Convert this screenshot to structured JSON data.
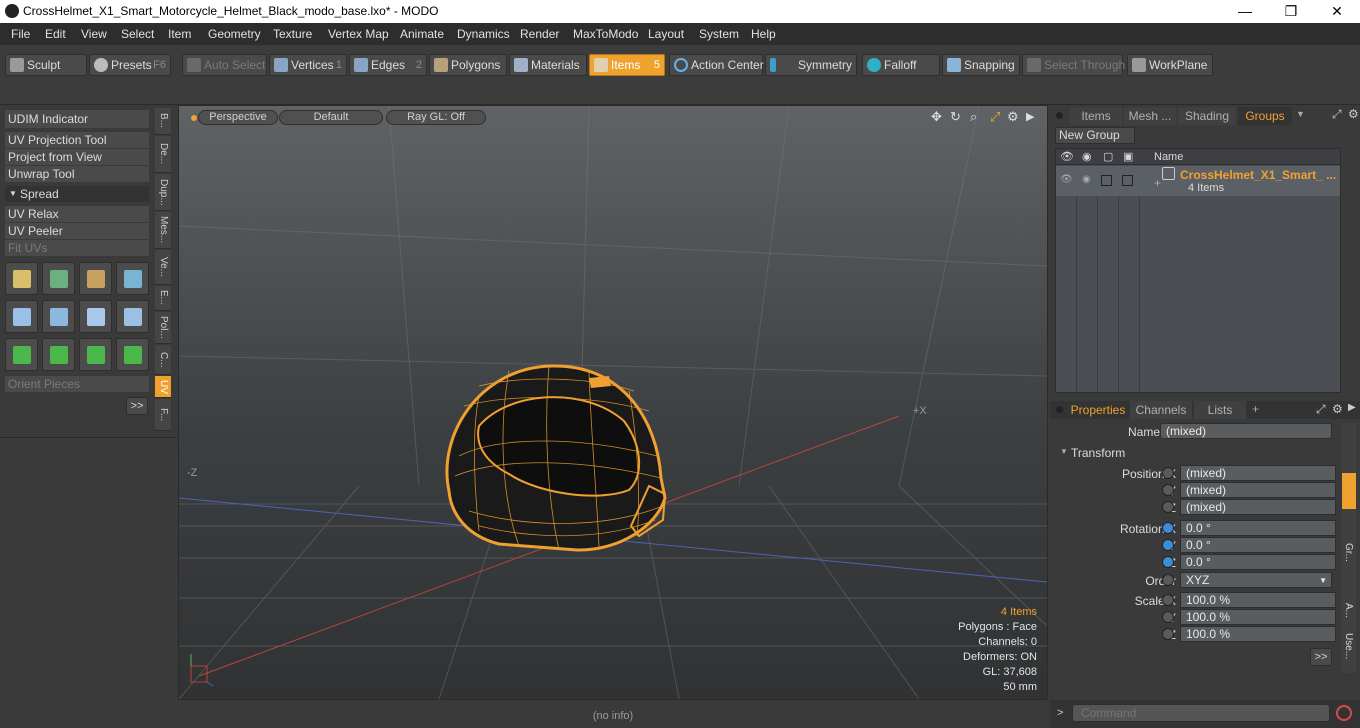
{
  "window": {
    "title": "CrossHelmet_X1_Smart_Motorcycle_Helmet_Black_modo_base.lxo* - MODO"
  },
  "menu": [
    "File",
    "Edit",
    "View",
    "Select",
    "Item",
    "Geometry",
    "Texture",
    "Vertex Map",
    "Animate",
    "Dynamics",
    "Render",
    "MaxToModo",
    "Layout",
    "System",
    "Help"
  ],
  "toolbar": {
    "sculpt": "Sculpt",
    "presets": "Presets",
    "presets_key": "F6",
    "auto_select": "Auto Select",
    "vertices": "Vertices",
    "vertices_key": "1",
    "edges": "Edges",
    "edges_key": "2",
    "polygons": "Polygons",
    "materials": "Materials",
    "items": "Items",
    "items_key": "5",
    "action_center": "Action Center",
    "symmetry": "Symmetry",
    "falloff": "Falloff",
    "snapping": "Snapping",
    "select_through": "Select Through",
    "workplane": "WorkPlane"
  },
  "left": {
    "udim": "UDIM Indicator",
    "uv_projection": "UV Projection Tool",
    "project_view": "Project from View",
    "unwrap": "Unwrap Tool",
    "spread": "Spread",
    "uv_relax": "UV Relax",
    "uv_peeler": "UV Peeler",
    "fit_uvs": "Fit UVs",
    "orient": "Orient Pieces",
    "more": ">>",
    "tabs": [
      "B...",
      "De...",
      "Dup...",
      "Mes...",
      "Ve...",
      "E...",
      "Pol...",
      "C...",
      "UV",
      "F..."
    ]
  },
  "viewport": {
    "perspective": "Perspective",
    "default": "Default",
    "raygl": "Ray GL: Off",
    "axis_x": "+X",
    "axis_z": "-Z",
    "info": {
      "items": "4 Items",
      "polygons": "Polygons : Face",
      "channels": "Channels: 0",
      "deformers": "Deformers: ON",
      "gl": "GL: 37,608",
      "lens": "50 mm"
    }
  },
  "status": "(no info)",
  "right": {
    "tabs": [
      "Items",
      "Mesh ...",
      "Shading",
      "Groups"
    ],
    "new_group": "New Group",
    "col_name": "Name",
    "group_name": "CrossHelmet_X1_Smart_ ...",
    "group_count": "4 Items",
    "prop_tabs": [
      "Properties",
      "Channels",
      "Lists"
    ],
    "plus": "+",
    "name_label": "Name",
    "name_value": "(mixed)",
    "transform": "Transform",
    "position_x_label": "Position X",
    "pos_x": "(mixed)",
    "pos_y": "(mixed)",
    "pos_z": "(mixed)",
    "rotation_x_label": "Rotation X",
    "rot_x": "0.0 °",
    "rot_y": "0.0 °",
    "rot_z": "0.0 °",
    "order_label": "Order",
    "order_value": "XYZ",
    "scale_x_label": "Scale X",
    "scale_x": "100.0 %",
    "scale_y": "100.0 %",
    "scale_z": "100.0 %",
    "y_label": "Y",
    "z_label": "Z",
    "more": ">>",
    "side_tabs": [
      "Gr...",
      "A...",
      "Use..."
    ],
    "command_placeholder": "Command"
  }
}
